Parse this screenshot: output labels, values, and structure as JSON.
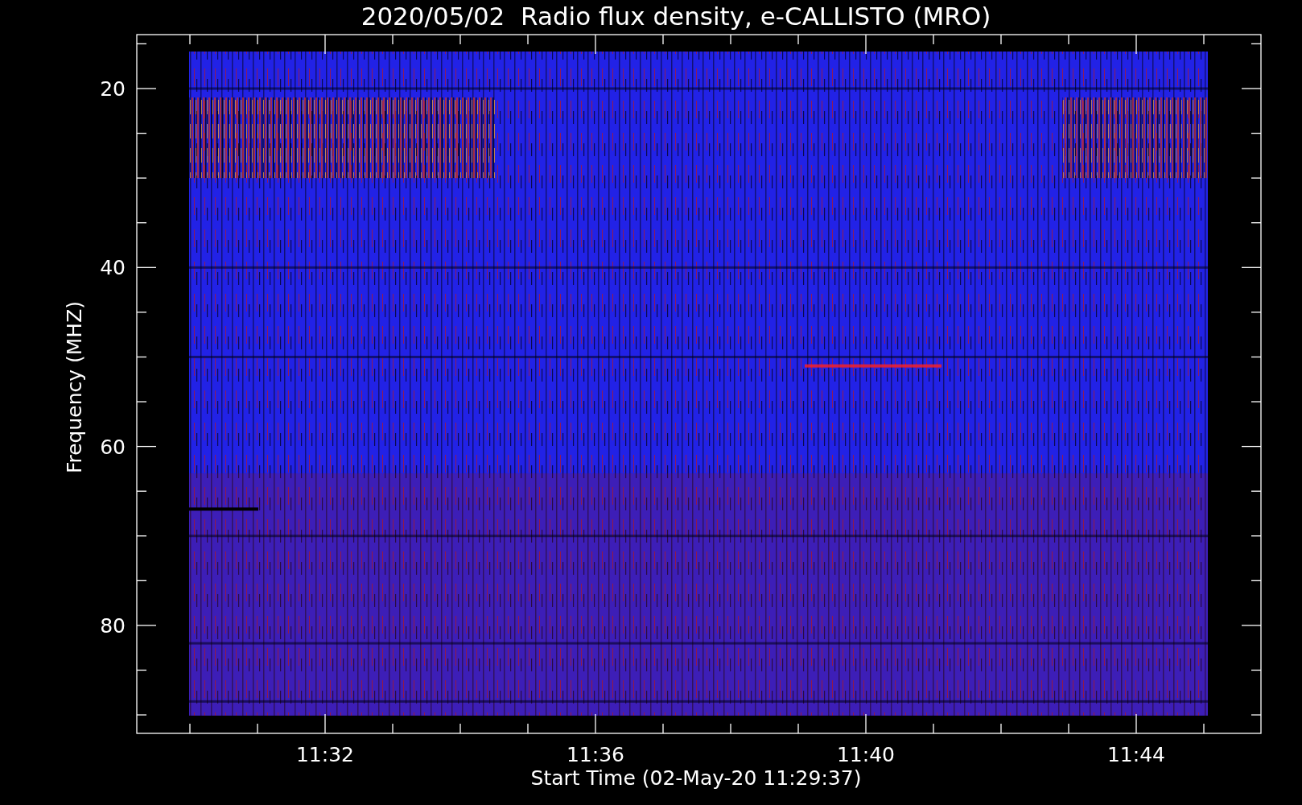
{
  "title": "2020/05/02  Radio flux density, e-CALLISTO (MRO)",
  "y_axis": {
    "title": "Frequency (MHZ)",
    "ticks": [
      "20",
      "40",
      "60",
      "80"
    ]
  },
  "x_axis": {
    "title": "Start Time (02-May-20 11:29:37)",
    "ticks": [
      "11:32",
      "11:36",
      "11:40",
      "11:44"
    ]
  }
}
